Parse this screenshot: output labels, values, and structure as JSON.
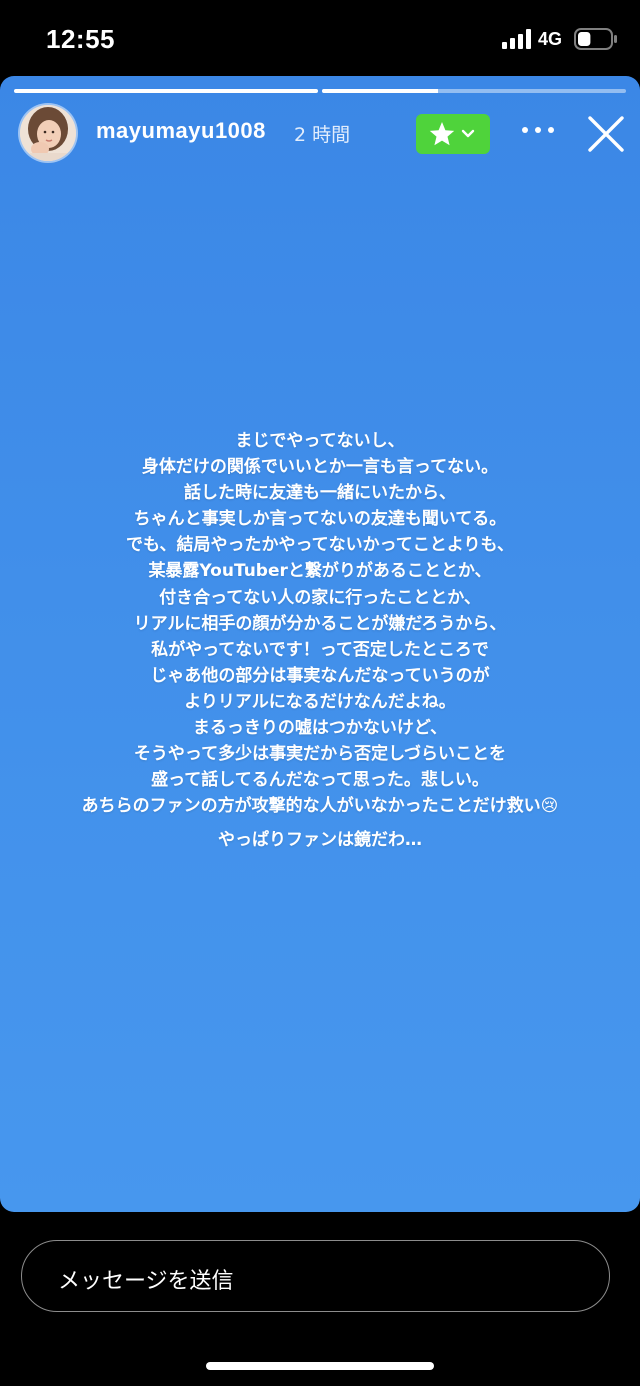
{
  "status_bar": {
    "time": "12:55",
    "network": "4G",
    "signal_icon": "cellular-signal-icon",
    "battery_icon": "battery-icon",
    "battery_level": 0.4
  },
  "story": {
    "progress_segments": [
      {
        "fill": 1.0
      },
      {
        "fill": 0.38
      }
    ],
    "username": "mayumayu1008",
    "posted_ago": "2 時間",
    "close_friends_icon": "star-icon",
    "more_icon": "more-horizontal-icon",
    "close_icon": "close-icon",
    "background_color": "#418fea",
    "lines": [
      "まじでやってないし、",
      "身体だけの関係でいいとか一言も言ってない。",
      "話した時に友達も一緒にいたから、",
      "ちゃんと事実しか言ってないの友達も聞いてる。",
      "でも、結局やったかやってないかってことよりも、",
      "某暴露YouTuberと繋がりがあることとか、",
      "付き合ってない人の家に行ったこととか、",
      "リアルに相手の顔が分かることが嫌だろうから、",
      "私がやってないです！って否定したところで",
      "じゃあ他の部分は事実なんだなっていうのが",
      "よりリアルになるだけなんだよね。",
      "まるっきりの嘘はつかないけど、",
      "そうやって多少は事実だから否定しづらいことを",
      "盛って話してるんだなって思った。悲しい。",
      "あちらのファンの方が攻撃的な人がいなかったことだけ救い😢"
    ],
    "last_line": "やっぱりファンは鏡だわ…"
  },
  "message_input": {
    "placeholder": "メッセージを送信"
  }
}
